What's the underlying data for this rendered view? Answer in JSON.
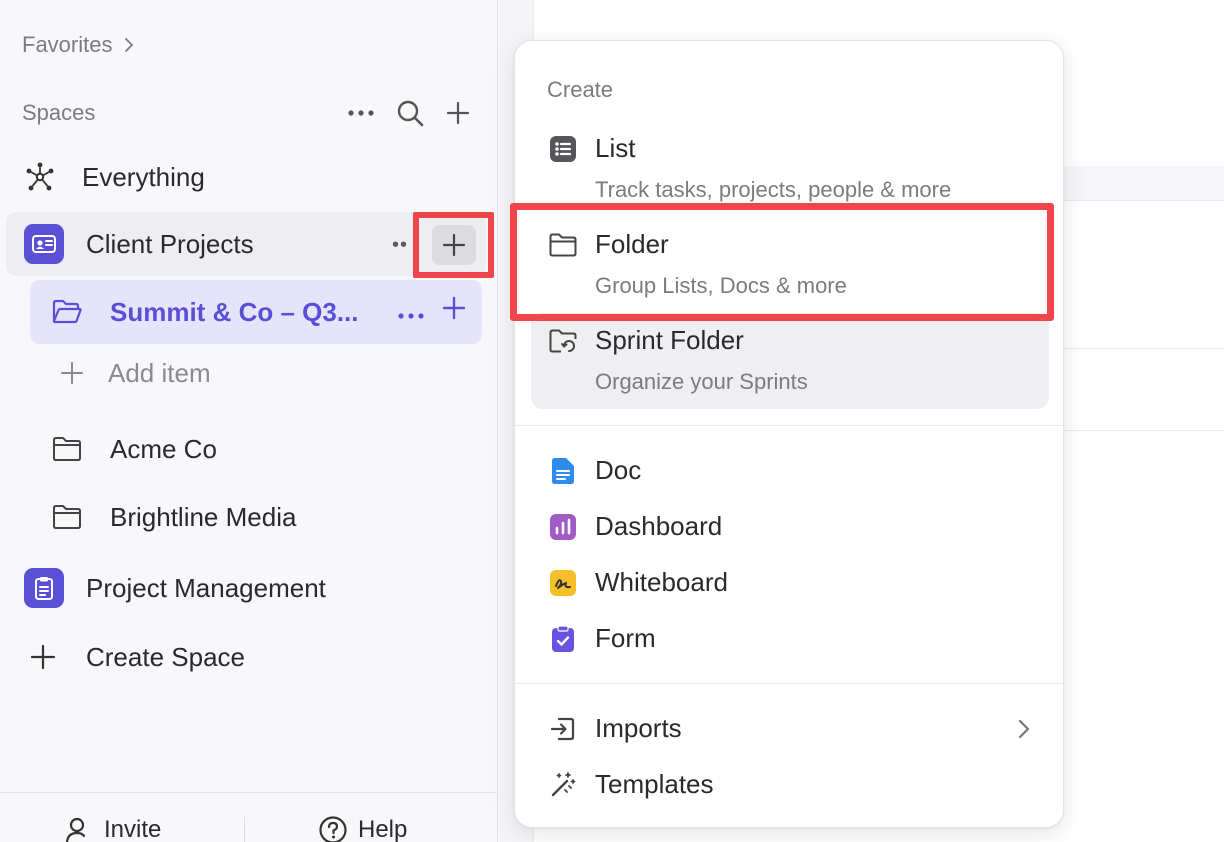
{
  "sidebar": {
    "favorites": "Favorites",
    "spaces_label": "Spaces",
    "items": {
      "everything": "Everything",
      "client_projects": "Client Projects",
      "summit": "Summit & Co – Q3...",
      "add_item": "Add item",
      "acme": "Acme Co",
      "brightline": "Brightline Media",
      "project_management": "Project Management",
      "create_space": "Create Space"
    },
    "footer": {
      "invite": "Invite",
      "help": "Help"
    }
  },
  "menu": {
    "header": "Create",
    "list": {
      "title": "List",
      "subtitle": "Track tasks, projects, people & more"
    },
    "folder": {
      "title": "Folder",
      "subtitle": "Group Lists, Docs & more"
    },
    "sprint_folder": {
      "title": "Sprint Folder",
      "subtitle": "Organize your Sprints"
    },
    "doc": "Doc",
    "dashboard": "Dashboard",
    "whiteboard": "Whiteboard",
    "form": "Form",
    "imports": "Imports",
    "templates": "Templates"
  },
  "colors": {
    "accent": "#5b4fd8",
    "highlight_border": "#f0454a",
    "doc_icon": "#2e8cf0",
    "dashboard_icon": "#a15bc4",
    "whiteboard_icon": "#f5bf2a",
    "form_icon": "#6a52e0"
  },
  "icons": {
    "everything": "network-icon",
    "client_projects": "id-card-icon",
    "summit": "folder-open-icon",
    "project_management": "clipboard-icon",
    "list": "list-icon",
    "folder": "folder-icon",
    "sprint_folder": "sprint-folder-icon",
    "doc": "doc-icon",
    "dashboard": "dashboard-icon",
    "whiteboard": "whiteboard-icon",
    "form": "form-icon",
    "imports": "import-icon",
    "templates": "magic-wand-icon"
  }
}
